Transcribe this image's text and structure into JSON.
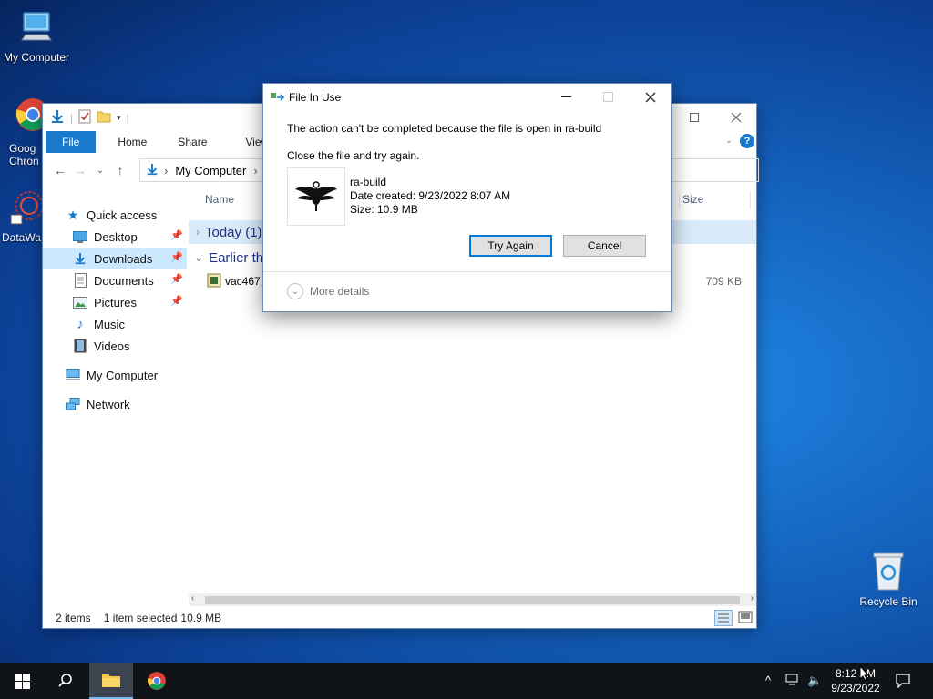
{
  "desktop": {
    "icons": [
      {
        "label": "My Computer"
      },
      {
        "label": "Goog Chron"
      },
      {
        "label": "DataWa"
      },
      {
        "label": "Recycle Bin"
      }
    ]
  },
  "explorer": {
    "ribbon_tabs": [
      "File",
      "Home",
      "Share",
      "View"
    ],
    "address": {
      "path": [
        "My Computer"
      ]
    },
    "nav": {
      "quick_access": "Quick access",
      "items": [
        {
          "label": "Desktop",
          "icon": "desktop-icon",
          "pinned": true
        },
        {
          "label": "Downloads",
          "icon": "downloads-icon",
          "pinned": true,
          "selected": true
        },
        {
          "label": "Documents",
          "icon": "documents-icon",
          "pinned": true
        },
        {
          "label": "Pictures",
          "icon": "pictures-icon",
          "pinned": true
        },
        {
          "label": "Music",
          "icon": "music-icon"
        },
        {
          "label": "Videos",
          "icon": "videos-icon"
        }
      ],
      "my_computer": "My Computer",
      "network": "Network"
    },
    "columns": {
      "name": "Name",
      "size": "Size"
    },
    "groups": [
      {
        "label": "Today (1)"
      },
      {
        "label": "Earlier th"
      }
    ],
    "file": {
      "name": "vac467",
      "size": "709 KB"
    },
    "status": {
      "items": "2 items",
      "selected": "1 item selected",
      "size": "10.9 MB"
    }
  },
  "dialog": {
    "title": "File In Use",
    "message": "The action can't be completed because the file is open in ra-build",
    "instruction": "Close the file and try again.",
    "app": {
      "name": "ra-build",
      "date_created": "Date created: 9/23/2022 8:07 AM",
      "size": "Size: 10.9 MB"
    },
    "try_again": "Try Again",
    "cancel": "Cancel",
    "more_details": "More details"
  },
  "taskbar": {
    "time": "8:12 AM",
    "date": "9/23/2022"
  },
  "colors": {
    "accent": "#1979ca",
    "selection": "#cce8ff",
    "taskbar": "#101418"
  }
}
